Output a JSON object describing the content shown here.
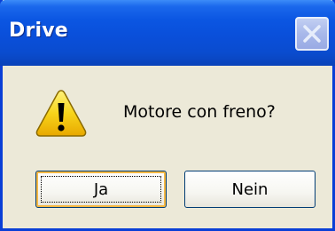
{
  "window": {
    "title": "Drive"
  },
  "dialog": {
    "message": "Motore con freno?",
    "icon": "warning-icon"
  },
  "buttons": {
    "yes_label": "Ja",
    "no_label": "Nein"
  },
  "colors": {
    "titlebar": "#0a4fda",
    "window_bg": "#ece9d8",
    "warning_yellow": "#f7c600"
  }
}
